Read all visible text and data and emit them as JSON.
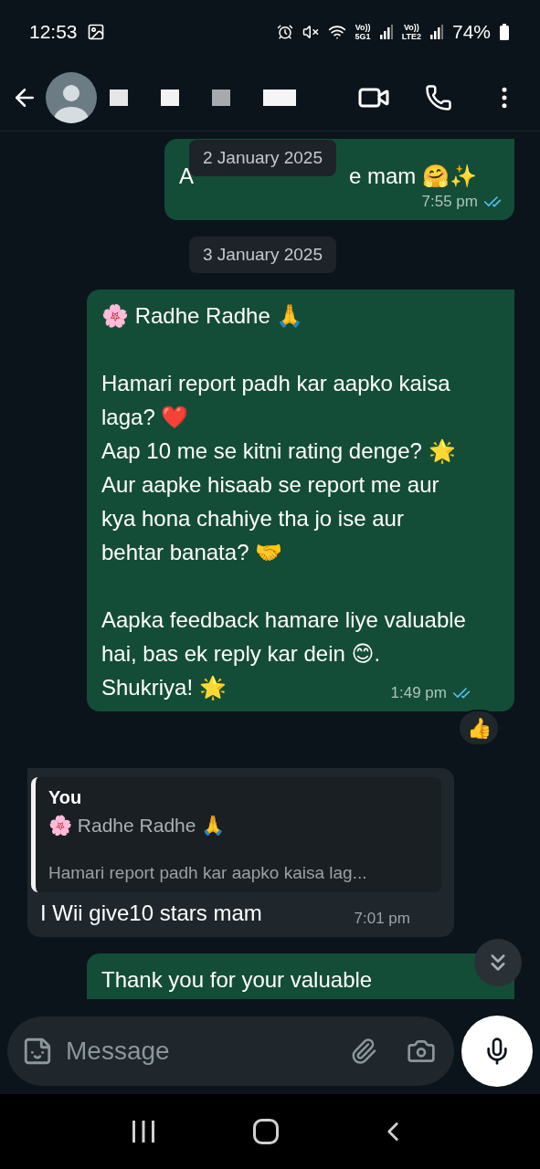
{
  "status_bar": {
    "time": "12:53",
    "sims": [
      {
        "top": "Vo))",
        "bottom": "5G1"
      },
      {
        "top": "Vo))",
        "bottom": "LTE2"
      }
    ],
    "battery": "74%"
  },
  "chat": {
    "sticky_date": "2 January 2025",
    "messages": [
      {
        "kind": "outgoing",
        "text_fragments": [
          "A",
          "e mam 🤗✨"
        ],
        "time": "7:55 pm",
        "read": true
      },
      {
        "kind": "date",
        "label": "3 January 2025"
      },
      {
        "kind": "outgoing",
        "paragraphs": [
          [
            "🌸 Radhe Radhe 🙏"
          ],
          [
            "Hamari report padh kar aapko kaisa laga? ❤️",
            "Aap 10 me se kitni rating denge? 🌟",
            "Aur aapke hisaab se report me aur kya hona chahiye tha jo ise aur behtar banata? 🤝"
          ],
          [
            "Aapka feedback hamare liye valuable hai, bas ek reply kar dein 😊.",
            "Shukriya! 🌟"
          ]
        ],
        "time": "1:49 pm",
        "read": true,
        "reaction": "👍"
      },
      {
        "kind": "incoming",
        "quote": {
          "author": "You",
          "title": "🌸 Radhe Radhe 🙏",
          "snippet": "Hamari report padh kar aapko kaisa lag..."
        },
        "paragraphs": [
          [
            "I Wii give10 stars mam"
          ]
        ],
        "time": "7:01 pm"
      },
      {
        "kind": "outgoing",
        "paragraphs": [
          [
            "Thank you for your valuable"
          ]
        ],
        "cut_off": true
      }
    ]
  },
  "composer": {
    "placeholder": "Message"
  }
}
